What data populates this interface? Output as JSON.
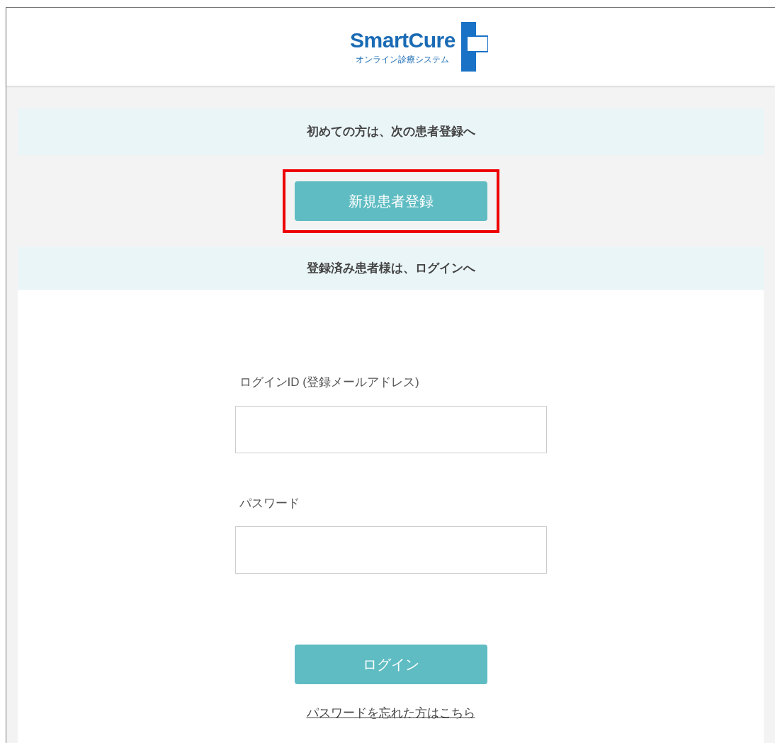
{
  "header": {
    "logo_name": "SmartCure",
    "logo_subtitle": "オンライン診療システム"
  },
  "register_section": {
    "heading": "初めての方は、次の患者登録へ",
    "button": {
      "label": "新規患者登録",
      "highlighted": true
    }
  },
  "login_section": {
    "heading": "登録済み患者様は、ログインへ",
    "fields": [
      {
        "label": "ログインID (登録メールアドレス)"
      },
      {
        "label": "パスワード"
      }
    ],
    "button": {
      "label": "ログイン"
    },
    "forgot_link": "パスワードを忘れた方はこちら"
  }
}
